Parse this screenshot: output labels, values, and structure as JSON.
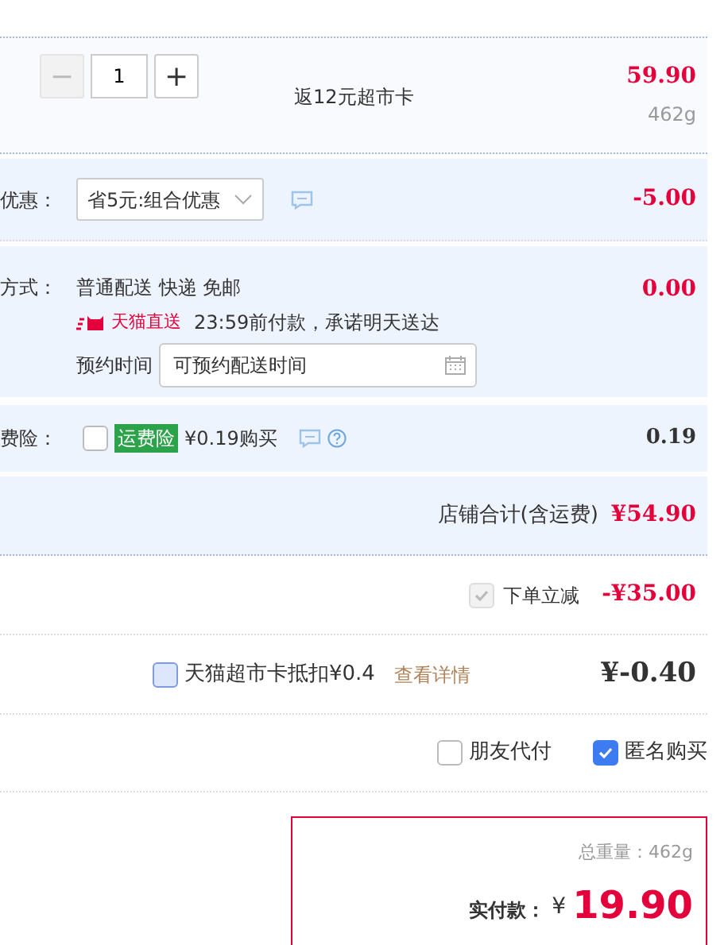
{
  "item": {
    "quantity": "1",
    "minus": "−",
    "plus": "+",
    "minus_disabled": true,
    "note": "返12元超市卡",
    "price": "59.90",
    "weight": "462g"
  },
  "promotion": {
    "label": "优惠：",
    "selected_option": "省5元:组合优惠",
    "amount": "-5.00"
  },
  "shipping": {
    "label": "方式：",
    "method": "普通配送 快递 免邮",
    "badge": "天猫直送",
    "promise": "23:59前付款，承诺明天送达",
    "schedule_label": "预约时间",
    "schedule_placeholder": "可预约配送时间",
    "amount": "0.00"
  },
  "insurance": {
    "label": "费险：",
    "checked": false,
    "badge": "运费险",
    "offer": "¥0.19购买",
    "amount": "0.19"
  },
  "shop_total": {
    "label": "店铺合计(含运费)",
    "amount": "¥54.90"
  },
  "discount": {
    "checked": true,
    "disabled": true,
    "label": "下单立减",
    "amount": "-¥35.00"
  },
  "card": {
    "checked": false,
    "label": "天猫超市卡抵扣¥0.4",
    "link": "查看详情",
    "amount": "¥-0.40"
  },
  "options": [
    {
      "label": "朋友代付",
      "checked": false
    },
    {
      "label": "匿名购买",
      "checked": true
    }
  ],
  "summary": {
    "weight": "总重量：462g",
    "pay_label": "实付款：",
    "currency": "¥",
    "amount": "19.90"
  }
}
